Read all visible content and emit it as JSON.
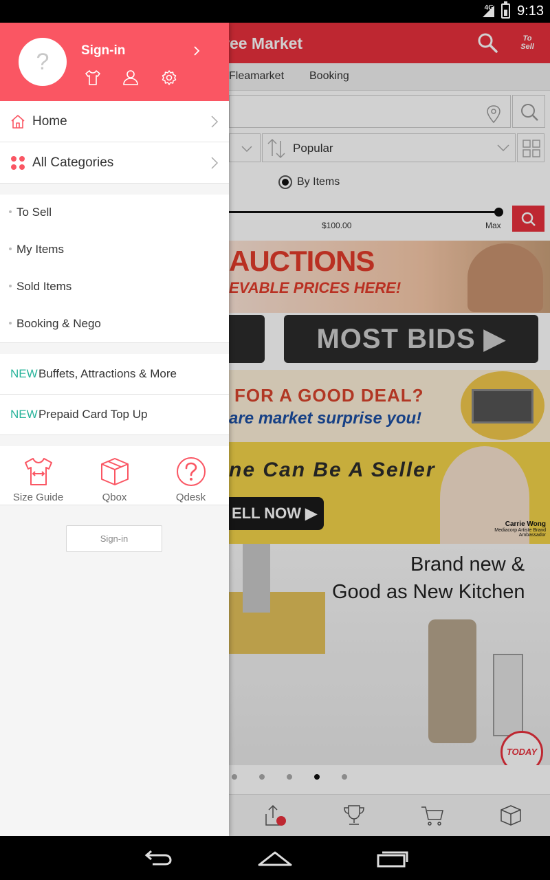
{
  "status_bar": {
    "network": "4G",
    "time": "9:13"
  },
  "app": {
    "title": "ree Market",
    "to_sell": "To Sell",
    "tabs": [
      "Fleamarket",
      "Booking"
    ],
    "sort_label": "Popular",
    "radio_label": "By Items",
    "price_label": "$100.00",
    "max_label": "Max",
    "banners": {
      "auctions_title": "AUCTIONS",
      "auctions_sub": "EVABLE PRICES HERE!",
      "left_btn": "",
      "most_bids": "MOST BIDS ▶",
      "deal_line1": "FOR A GOOD DEAL?",
      "deal_line2": "are market surprise you!",
      "seller_line1": "ne Can Be A Seller",
      "seller_btn": "ELL NOW ▶",
      "seller_name": "Carrie Wong",
      "seller_title": "Mediacorp Artiste Brand Ambassador",
      "kitchen_line1": "Brand new &",
      "kitchen_line2": "Good as New Kitchen",
      "today": "TODAY"
    },
    "carousel": {
      "count": 5,
      "active_index": 3
    }
  },
  "drawer": {
    "header": {
      "avatar_glyph": "?",
      "signin_label": "Sign-in"
    },
    "main_items": [
      {
        "label": "Home",
        "icon": "home-icon"
      },
      {
        "label": "All Categories",
        "icon": "categories-icon"
      }
    ],
    "sub_items": [
      "To Sell",
      "My Items",
      "Sold Items",
      "Booking & Nego"
    ],
    "new_items": [
      {
        "tag": "NEW",
        "label": "Buffets, Attractions & More"
      },
      {
        "tag": "NEW",
        "label": "Prepaid Card Top Up"
      }
    ],
    "shortcuts": [
      {
        "label": "Size Guide",
        "icon": "tshirt-icon"
      },
      {
        "label": "Qbox",
        "icon": "box-icon"
      },
      {
        "label": "Qdesk",
        "icon": "help-icon"
      }
    ],
    "signin_button": "Sign-in"
  },
  "colors": {
    "drawer_header": "#fa5663",
    "app_header": "#e8303c",
    "new_tag": "#27b39a",
    "icon_accent": "#fa5663"
  }
}
